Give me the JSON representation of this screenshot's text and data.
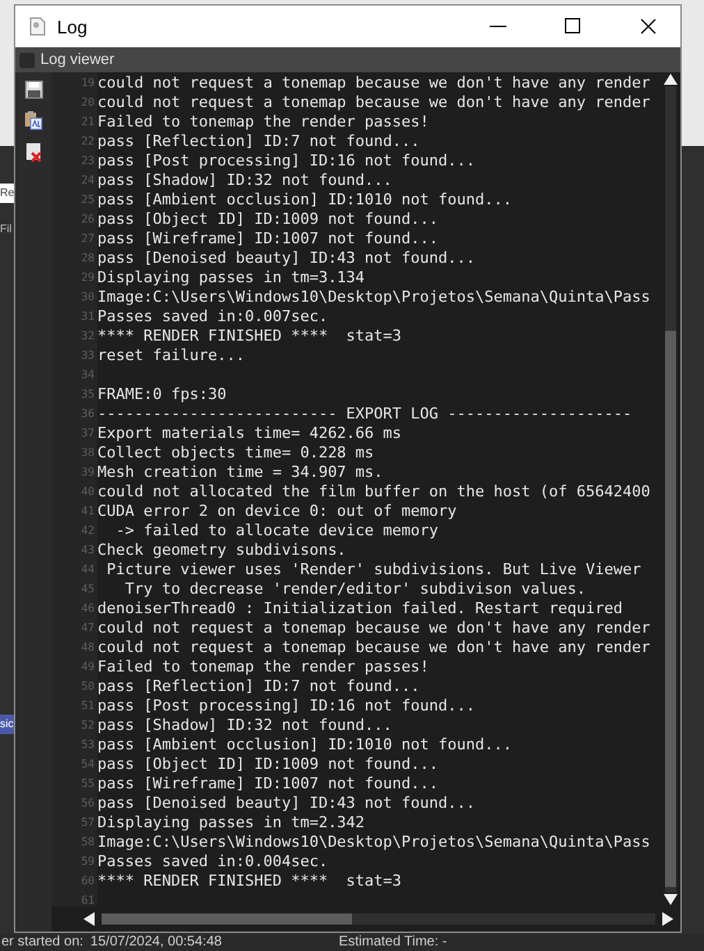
{
  "background_app": {
    "fragments": [
      "Re",
      "Fil",
      "sic"
    ],
    "status_label": "er started on:",
    "status_value": "15/07/2024, 00:54:48",
    "estimated": "Estimated Time: -"
  },
  "window": {
    "title": "Log"
  },
  "log_viewer": {
    "label": "Log viewer",
    "checked": false
  },
  "lines": [
    {
      "number": "19",
      "text": "could not request a tonemap because we don't have any render"
    },
    {
      "number": "20",
      "text": "could not request a tonemap because we don't have any render"
    },
    {
      "number": "21",
      "text": "Failed to tonemap the render passes!"
    },
    {
      "number": "22",
      "text": "pass [Reflection] ID:7 not found..."
    },
    {
      "number": "23",
      "text": "pass [Post processing] ID:16 not found..."
    },
    {
      "number": "24",
      "text": "pass [Shadow] ID:32 not found..."
    },
    {
      "number": "25",
      "text": "pass [Ambient occlusion] ID:1010 not found..."
    },
    {
      "number": "26",
      "text": "pass [Object ID] ID:1009 not found..."
    },
    {
      "number": "27",
      "text": "pass [Wireframe] ID:1007 not found..."
    },
    {
      "number": "28",
      "text": "pass [Denoised beauty] ID:43 not found..."
    },
    {
      "number": "29",
      "text": "Displaying passes in tm=3.134"
    },
    {
      "number": "30",
      "text": "Image:C:\\Users\\Windows10\\Desktop\\Projetos\\Semana\\Quinta\\Pass"
    },
    {
      "number": "31",
      "text": "Passes saved in:0.007sec."
    },
    {
      "number": "32",
      "text": "**** RENDER FINISHED ****  stat=3"
    },
    {
      "number": "33",
      "text": "reset failure..."
    },
    {
      "number": "34"
    },
    {
      "number": "35",
      "text": "FRAME:0 fps:30"
    },
    {
      "number": "36",
      "text": "-------------------------- EXPORT LOG --------------------"
    },
    {
      "number": "37",
      "text": "Export materials time= 4262.66 ms"
    },
    {
      "number": "38",
      "text": "Collect objects time= 0.228 ms"
    },
    {
      "number": "39",
      "text": "Mesh creation time = 34.907 ms."
    },
    {
      "number": "40",
      "text": "could not allocated the film buffer on the host (of 65642400"
    },
    {
      "number": "41",
      "text": "CUDA error 2 on device 0: out of memory"
    },
    {
      "number": "42",
      "text": "  -> failed to allocate device memory"
    },
    {
      "number": "43",
      "text": "Check geometry subdivisons."
    },
    {
      "number": "44",
      "text": " Picture viewer uses 'Render' subdivisions. But Live Viewer"
    },
    {
      "number": "45",
      "text": "   Try to decrease 'render/editor' subdivison values."
    },
    {
      "number": "46",
      "text": "denoiserThread0 : Initialization failed. Restart required"
    },
    {
      "number": "47",
      "text": "could not request a tonemap because we don't have any render"
    },
    {
      "number": "48",
      "text": "could not request a tonemap because we don't have any render"
    },
    {
      "number": "49",
      "text": "Failed to tonemap the render passes!"
    },
    {
      "number": "50",
      "text": "pass [Reflection] ID:7 not found..."
    },
    {
      "number": "51",
      "text": "pass [Post processing] ID:16 not found..."
    },
    {
      "number": "52",
      "text": "pass [Shadow] ID:32 not found..."
    },
    {
      "number": "53",
      "text": "pass [Ambient occlusion] ID:1010 not found..."
    },
    {
      "number": "54",
      "text": "pass [Object ID] ID:1009 not found..."
    },
    {
      "number": "55",
      "text": "pass [Wireframe] ID:1007 not found..."
    },
    {
      "number": "56",
      "text": "pass [Denoised beauty] ID:43 not found..."
    },
    {
      "number": "57",
      "text": "Displaying passes in tm=2.342"
    },
    {
      "number": "58",
      "text": "Image:C:\\Users\\Windows10\\Desktop\\Projetos\\Semana\\Quinta\\Pass"
    },
    {
      "number": "59",
      "text": "Passes saved in:0.004sec."
    },
    {
      "number": "60",
      "text": "**** RENDER FINISHED ****  stat=3"
    },
    {
      "number": "61"
    }
  ]
}
